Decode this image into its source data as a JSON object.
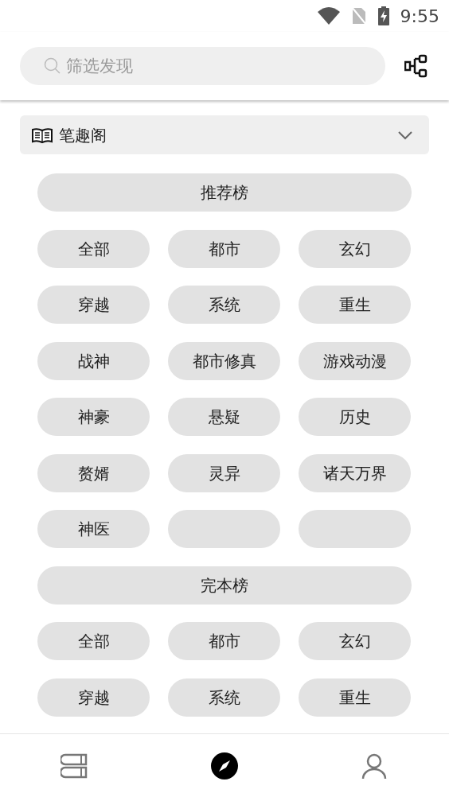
{
  "status_bar": {
    "time": "9:55"
  },
  "search": {
    "placeholder": "筛选发现"
  },
  "source": {
    "name": "笔趣阁",
    "expanded": false
  },
  "sections": [
    {
      "title": "推荐榜",
      "tags": [
        {
          "kind": "tag",
          "label": "全部"
        },
        {
          "kind": "tag",
          "label": "都市"
        },
        {
          "kind": "tag",
          "label": "玄幻"
        },
        {
          "kind": "tag",
          "label": "穿越"
        },
        {
          "kind": "tag",
          "label": "系统"
        },
        {
          "kind": "tag",
          "label": "重生"
        },
        {
          "kind": "tag",
          "label": "战神"
        },
        {
          "kind": "tag",
          "label": "都市修真"
        },
        {
          "kind": "tag",
          "label": "游戏动漫"
        },
        {
          "kind": "tag",
          "label": "神豪"
        },
        {
          "kind": "tag",
          "label": "悬疑"
        },
        {
          "kind": "tag",
          "label": "历史"
        },
        {
          "kind": "tag",
          "label": "赘婿"
        },
        {
          "kind": "tag",
          "label": "灵异"
        },
        {
          "kind": "tag",
          "label": "诸天万界"
        },
        {
          "kind": "tag",
          "label": "神医"
        },
        {
          "kind": "blank"
        },
        {
          "kind": "blank"
        }
      ]
    },
    {
      "title": "完本榜",
      "tags": [
        {
          "kind": "tag",
          "label": "全部"
        },
        {
          "kind": "tag",
          "label": "都市"
        },
        {
          "kind": "tag",
          "label": "玄幻"
        },
        {
          "kind": "tag",
          "label": "穿越"
        },
        {
          "kind": "tag",
          "label": "系统"
        },
        {
          "kind": "tag",
          "label": "重生"
        }
      ]
    }
  ],
  "bottom_nav": [
    {
      "kind": "bookshelf",
      "selected": false
    },
    {
      "kind": "discover",
      "selected": true
    },
    {
      "kind": "profile",
      "selected": false
    }
  ]
}
